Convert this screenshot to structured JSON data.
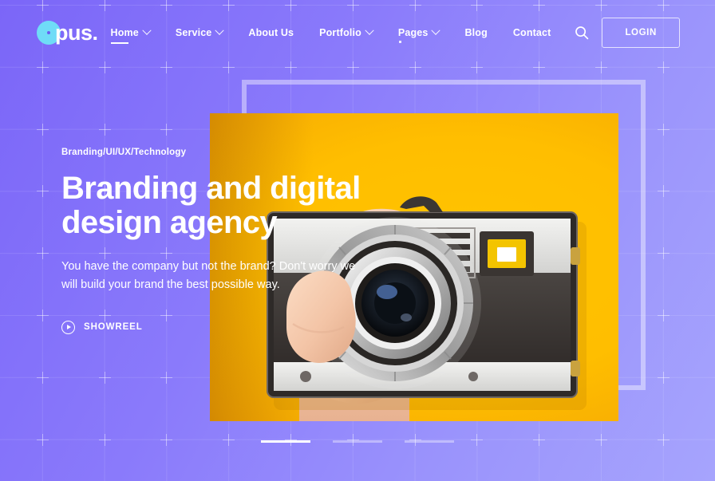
{
  "brand": {
    "logo_text": "pus.",
    "logo_icon": "circle-dot-icon",
    "accent_cyan": "#6fdcf7",
    "bg_purple_dark": "#7b66f8",
    "bg_purple_light": "#a6a4fd",
    "image_yellow": "#ffc400"
  },
  "nav": {
    "items": [
      {
        "label": "Home",
        "has_chevron": true,
        "state": "active"
      },
      {
        "label": "Service",
        "has_chevron": true,
        "state": "normal"
      },
      {
        "label": "About Us",
        "has_chevron": false,
        "state": "normal"
      },
      {
        "label": "Portfolio",
        "has_chevron": true,
        "state": "normal"
      },
      {
        "label": "Pages",
        "has_chevron": true,
        "state": "dotted"
      },
      {
        "label": "Blog",
        "has_chevron": false,
        "state": "normal"
      },
      {
        "label": "Contact",
        "has_chevron": false,
        "state": "normal"
      }
    ],
    "search_icon": "search-icon",
    "login_label": "LOGIN"
  },
  "hero": {
    "eyebrow": "Branding/UI/UX/Technology",
    "headline": "Branding and digital design agency",
    "subtext": "You have the company but not the brand? Don't worry we will build your brand the best possible way.",
    "showreel_label": "SHOWREEL",
    "showreel_icon": "play-circle-icon",
    "image_alt": "hand-holding-vintage-camera-on-yellow"
  },
  "slider": {
    "slides": [
      {
        "index": 1,
        "active": true
      },
      {
        "index": 2,
        "active": false
      },
      {
        "index": 3,
        "active": false
      }
    ]
  }
}
